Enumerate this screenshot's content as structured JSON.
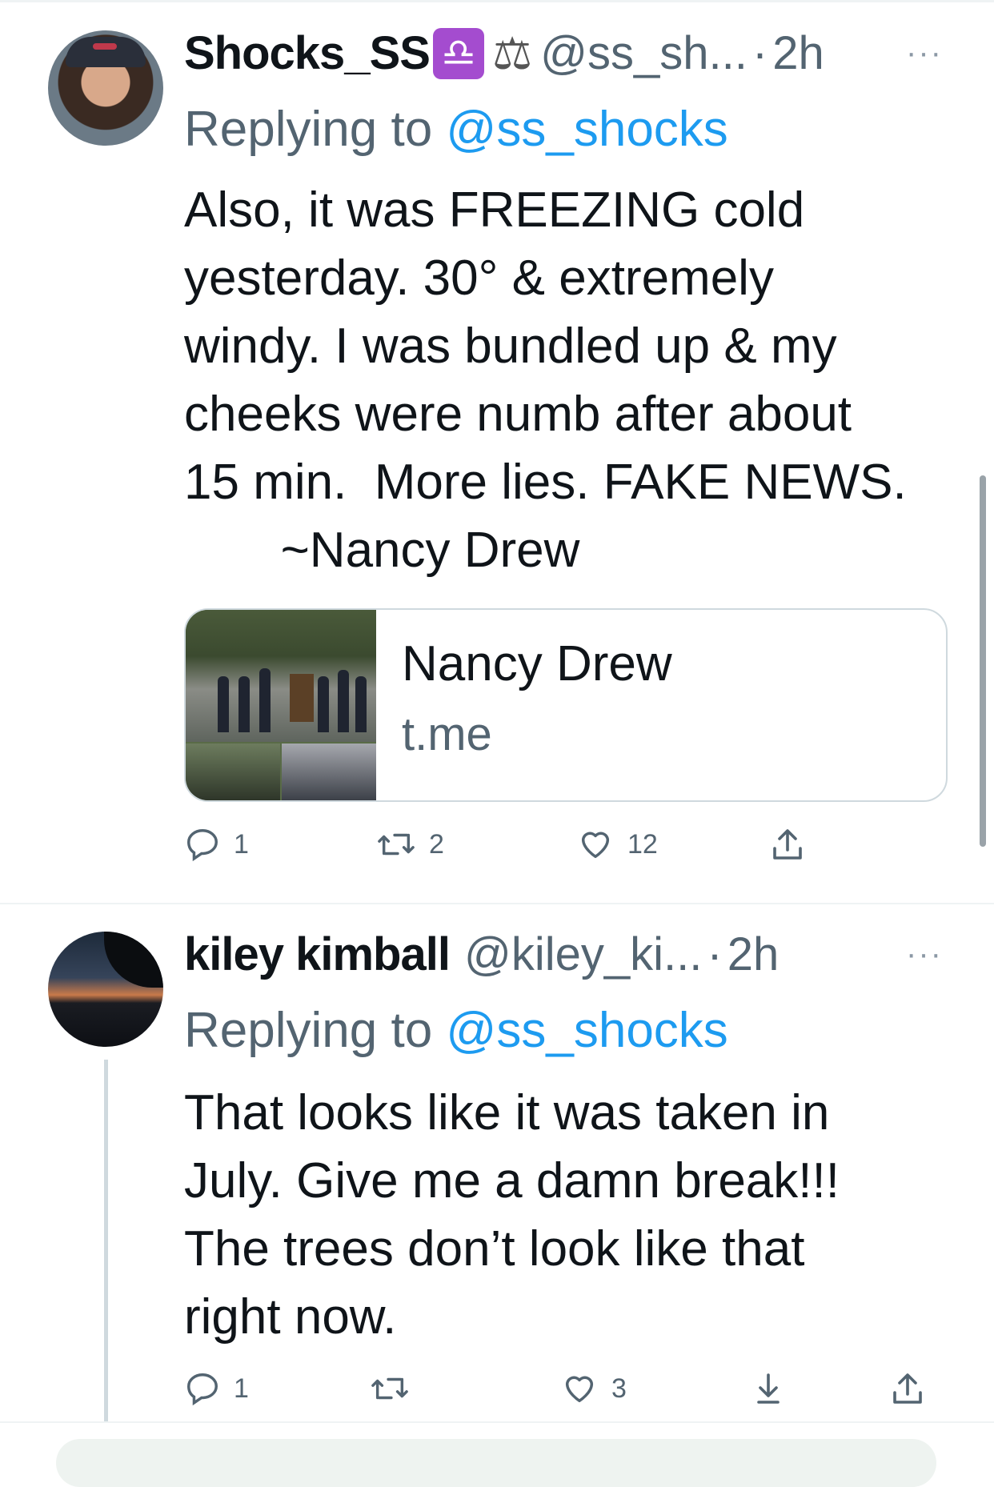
{
  "tweets": [
    {
      "name": "Shocks_SS",
      "badge_glyph": "♎",
      "scales_glyph": "⚖",
      "handle": "@ss_sh...",
      "sep": "·",
      "time": "2h",
      "more": "···",
      "reply_prefix": "Replying to ",
      "reply_handle": "@ss_shocks",
      "text": "Also, it was FREEZING cold\nyesterday. 30° & extremely\nwindy. I was bundled up & my\ncheeks were numb after about\n15 min.  More lies. FAKE NEWS.\n       ~Nancy Drew",
      "card": {
        "title": "Nancy Drew",
        "domain": "t.me"
      },
      "actions": {
        "reply_count": "1",
        "retweet_count": "2",
        "like_count": "12"
      }
    },
    {
      "name": "kiley kimball",
      "handle": "@kiley_ki...",
      "sep": "·",
      "time": "2h",
      "more": "···",
      "reply_prefix": "Replying to ",
      "reply_handle": "@ss_shocks",
      "text": "That looks like it was taken in\nJuly. Give me a damn break!!!\nThe trees don’t look like that\nright now.",
      "actions": {
        "reply_count": "1",
        "retweet_count": "",
        "like_count": "3"
      }
    }
  ],
  "icons": {
    "reply": "reply-icon",
    "retweet": "retweet-icon",
    "like": "heart-icon",
    "share": "share-icon",
    "download": "download-icon"
  },
  "colors": {
    "link": "#1d9bf0",
    "secondary_text": "#536471",
    "badge": "#a44ccf"
  }
}
